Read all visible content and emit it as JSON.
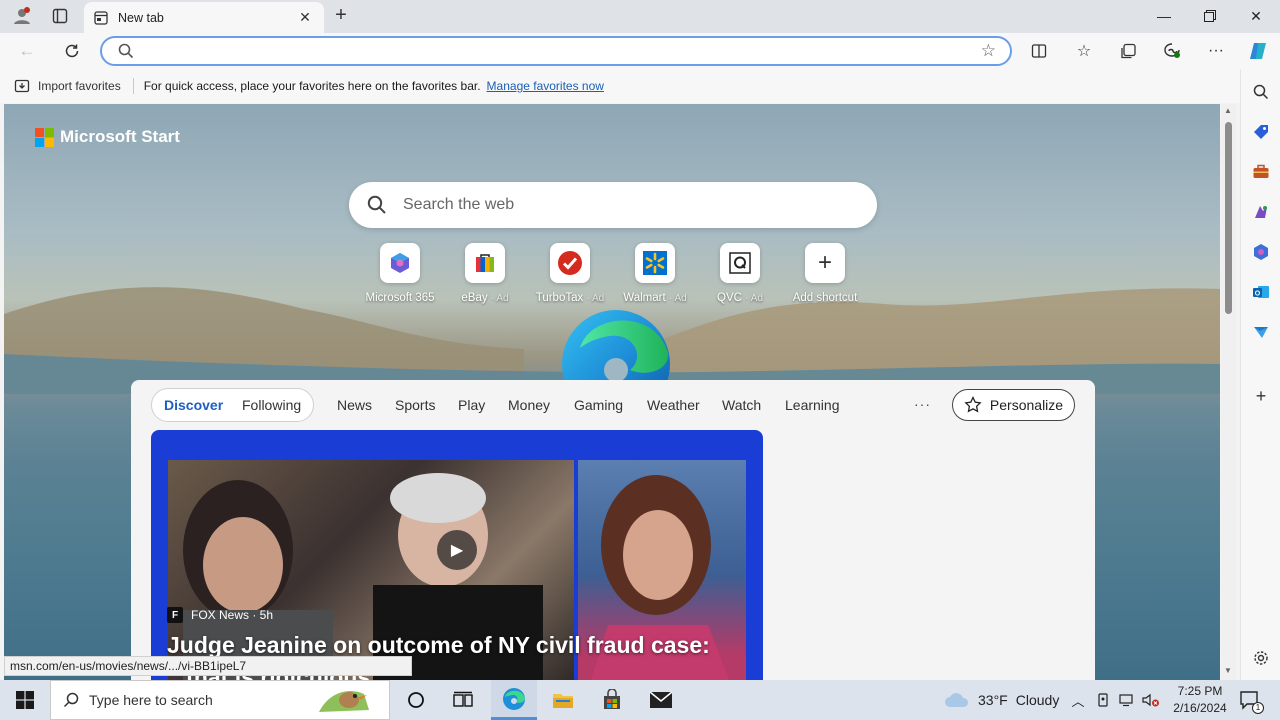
{
  "browser": {
    "tab_title": "New tab",
    "address_value": "",
    "favorites_bar": {
      "import_label": "Import favorites",
      "message": "For quick access, place your favorites here on the favorites bar.",
      "manage_link": "Manage favorites now"
    }
  },
  "newtab": {
    "brand": "Microsoft Start",
    "search_placeholder": "Search the web",
    "shortcuts": [
      {
        "label": "Microsoft 365",
        "ad": ""
      },
      {
        "label": "eBay",
        "ad": "· Ad"
      },
      {
        "label": "TurboTax",
        "ad": "· Ad"
      },
      {
        "label": "Walmart",
        "ad": "· Ad"
      },
      {
        "label": "QVC",
        "ad": "· Ad"
      },
      {
        "label": "Add shortcut",
        "ad": ""
      }
    ],
    "feed_tabs": [
      "Discover",
      "Following",
      "News",
      "Sports",
      "Play",
      "Money",
      "Gaming",
      "Weather",
      "Watch",
      "Learning"
    ],
    "more_label": "···",
    "personalize_label": "Personalize",
    "hero": {
      "source": "FOX News · 5h",
      "headline": "Judge Jeanine on outcome of NY civil fraud case:",
      "subline": "...that is ridiculous"
    }
  },
  "status_url": "msn.com/en-us/movies/news/.../vi-BB1ipeL7",
  "taskbar": {
    "search_placeholder": "Type here to search",
    "weather_temp": "33°F",
    "weather_desc": "Cloudy",
    "time": "7:25 PM",
    "date": "2/16/2024",
    "notification_count": "1"
  },
  "colors": {
    "accent": "#1f5ec4",
    "hero_bg": "#1a3dd6",
    "address_border": "#6a9ee8"
  }
}
